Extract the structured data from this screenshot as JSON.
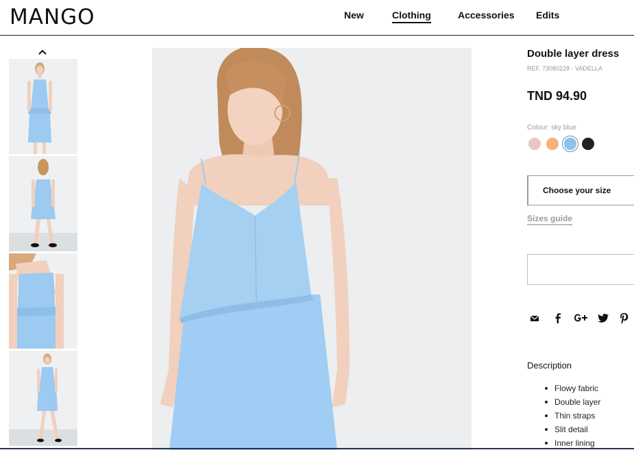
{
  "header": {
    "logo": "MANGO",
    "nav": [
      {
        "label": "New",
        "active": false
      },
      {
        "label": "Clothing",
        "active": true
      },
      {
        "label": "Accessories",
        "active": false
      },
      {
        "label": "Edits",
        "active": false
      }
    ]
  },
  "gallery": {
    "up_icon": "chevron-up-icon",
    "thumbnails": [
      "front view",
      "back view",
      "detail view",
      "full length view"
    ]
  },
  "product": {
    "title": "Double layer dress",
    "ref": "REF. 73080228 - VADELLA",
    "price": "TND 94.90",
    "colour_label": "Colour: sky blue",
    "colours": [
      {
        "name": "pink",
        "hex": "#e6c9c0",
        "selected": false
      },
      {
        "name": "apricot",
        "hex": "#f6b27a",
        "selected": false
      },
      {
        "name": "sky blue",
        "hex": "#8fc1ea",
        "selected": true
      },
      {
        "name": "black",
        "hex": "#222222",
        "selected": false
      }
    ],
    "size_label": "Choose your size",
    "sizes_guide": "Sizes guide"
  },
  "share": {
    "icons": [
      "mail-icon",
      "facebook-icon",
      "google-plus-icon",
      "twitter-icon",
      "pinterest-icon"
    ]
  },
  "description": {
    "title": "Description",
    "items": [
      "Flowy fabric",
      "Double layer",
      "Thin straps",
      "Slit detail",
      "Inner lining"
    ]
  },
  "colors": {
    "dress": "#9ccaf0",
    "background": "#eceef0",
    "text": "#111111",
    "muted": "#9a9a9a"
  }
}
